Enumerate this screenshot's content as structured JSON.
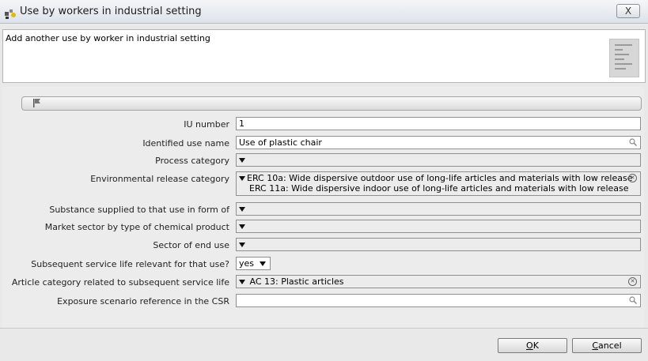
{
  "window": {
    "title": "Use by workers in industrial setting",
    "close_label": "X"
  },
  "header": {
    "text": "Add another use by worker in industrial setting"
  },
  "form": {
    "iu_number": {
      "label": "IU number",
      "value": "1"
    },
    "identified_use_name": {
      "label": "Identified use name",
      "value": "Use of plastic chair"
    },
    "process_category": {
      "label": "Process category",
      "value": ""
    },
    "environmental_release_category": {
      "label": "Environmental release category",
      "values": [
        "ERC 10a: Wide dispersive outdoor use of long-life articles and materials with low release",
        "ERC 11a: Wide dispersive indoor use of long-life articles and materials with low release"
      ]
    },
    "substance_supplied": {
      "label": "Substance supplied to that use in form of",
      "value": ""
    },
    "market_sector": {
      "label": "Market sector by type of chemical product",
      "value": ""
    },
    "sector_end_use": {
      "label": "Sector of end use",
      "value": ""
    },
    "subsequent_service_life": {
      "label": "Subsequent service life relevant for that use?",
      "value": "yes"
    },
    "article_category": {
      "label": "Article category related to subsequent service life",
      "value": "AC 13: Plastic articles"
    },
    "exposure_scenario": {
      "label": "Exposure scenario reference in the CSR",
      "value": ""
    }
  },
  "buttons": {
    "ok": {
      "prefix": "",
      "underlined": "O",
      "suffix": "K"
    },
    "cancel": {
      "prefix": "",
      "underlined": "C",
      "suffix": "ancel"
    }
  }
}
